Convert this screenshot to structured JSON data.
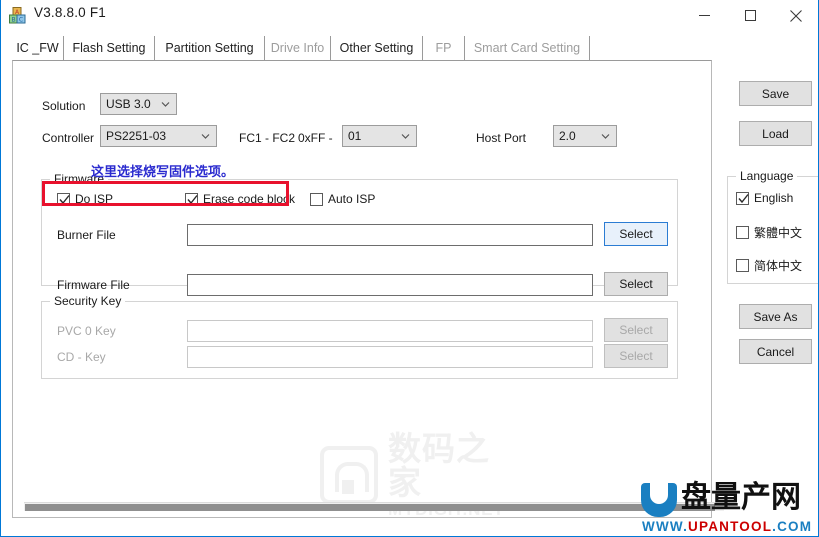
{
  "window": {
    "title": "V3.8.8.0 F1",
    "icon": "app-blocks-icon",
    "minimize": "minimize-icon",
    "maximize": "maximize-icon",
    "close": "close-icon"
  },
  "tabs": [
    {
      "label": "IC _FW",
      "selected": true,
      "enabled": true
    },
    {
      "label": "Flash Setting",
      "selected": false,
      "enabled": true
    },
    {
      "label": "Partition Setting",
      "selected": false,
      "enabled": true
    },
    {
      "label": "Drive Info",
      "selected": false,
      "enabled": false
    },
    {
      "label": "Other Setting",
      "selected": false,
      "enabled": true
    },
    {
      "label": "FP",
      "selected": false,
      "enabled": false
    },
    {
      "label": "Smart Card Setting",
      "selected": false,
      "enabled": false
    }
  ],
  "main": {
    "solution": {
      "label": "Solution",
      "value": "USB 3.0"
    },
    "controller": {
      "label": "Controller",
      "value": "PS2251-03"
    },
    "fc_label": "FC1 - FC2",
    "fc_prefix": "0xFF -",
    "fc_value": "01",
    "host_port": {
      "label": "Host Port",
      "value": "2.0"
    },
    "firmware_group": {
      "title": "Firmware",
      "checkboxes": [
        {
          "label": "Do ISP",
          "checked": true
        },
        {
          "label": "Erase code block",
          "checked": true
        },
        {
          "label": "Auto ISP",
          "checked": false
        }
      ],
      "burner_file": {
        "label": "Burner File",
        "value": "",
        "button": "Select"
      },
      "firmware_file": {
        "label": "Firmware File",
        "value": "",
        "button": "Select"
      }
    },
    "security_group": {
      "title": "Security Key",
      "pvc_key": {
        "label": "PVC 0 Key",
        "value": "",
        "button": "Select"
      },
      "cd_key": {
        "label": "CD - Key",
        "value": "",
        "button": "Select"
      }
    }
  },
  "sidebar": {
    "save": "Save",
    "load": "Load",
    "language": {
      "title": "Language",
      "options": [
        {
          "label": "English",
          "checked": true
        },
        {
          "label": "繁體中文",
          "checked": false
        },
        {
          "label": "简体中文",
          "checked": false
        }
      ]
    },
    "save_as": "Save As",
    "cancel": "Cancel"
  },
  "annotations": {
    "note_cn": "这里选择烧写固件选项。",
    "note_color": "#2b2bcf",
    "highlight_color": "#e8112d"
  },
  "watermarks": {
    "center": {
      "cn": "数码之家",
      "en": "MYDIGIT.NET"
    },
    "bottom_right": {
      "cn": "盘量产网",
      "url_prefix": "WWW.",
      "url_mid": "UPANTOOL",
      "url_suffix": ".COM"
    }
  }
}
